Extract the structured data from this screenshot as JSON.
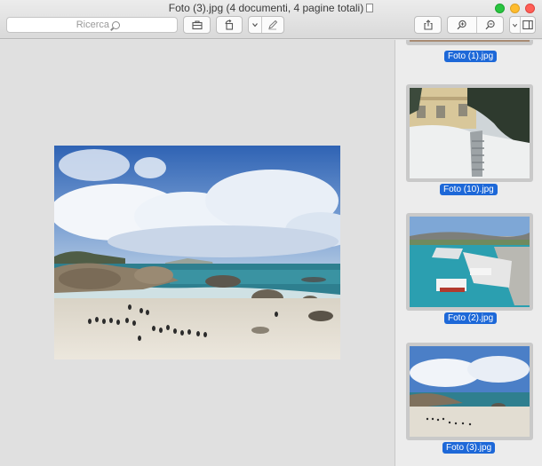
{
  "window": {
    "title": "Foto (3).jpg (4 documenti, 4 pagine totali)"
  },
  "toolbar": {
    "search_placeholder": "Ricerca",
    "icons": [
      "search-icon",
      "toolbox-icon",
      "rotate-icon",
      "markup-pen-icon",
      "chevron-down-icon",
      "share-icon",
      "zoom-in-icon",
      "zoom-out-icon",
      "sidebar-toggle-icon"
    ]
  },
  "sidebar": {
    "thumbnails": [
      {
        "label": "Foto (1).jpg"
      },
      {
        "label": "Foto (10).jpg"
      },
      {
        "label": "Foto (2).jpg"
      },
      {
        "label": "Foto (3).jpg",
        "selected": true
      }
    ]
  },
  "colors": {
    "selection": "#1d68d8",
    "toolbar_bg": "#dedede",
    "canvas_bg": "#e0e0e0"
  }
}
